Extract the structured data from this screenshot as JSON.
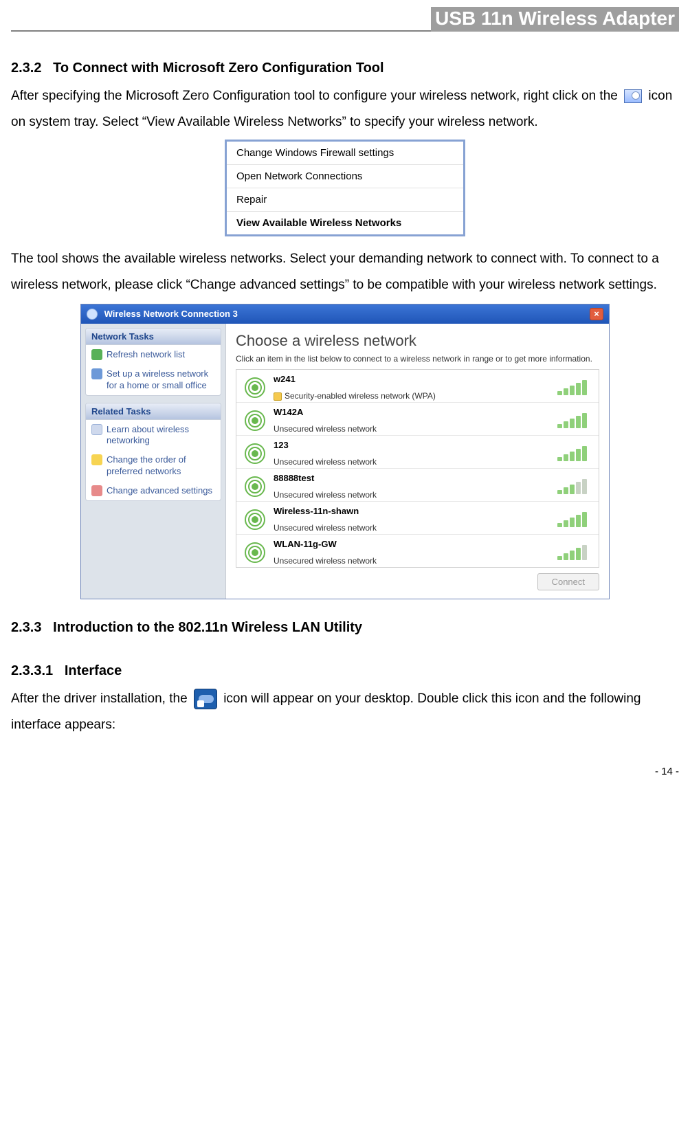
{
  "header": {
    "title": "USB 11n Wireless Adapter"
  },
  "sec_232": {
    "num": "2.3.2",
    "title": "To Connect with Microsoft Zero Configuration Tool",
    "para1a": "After specifying the Microsoft Zero Configuration tool to configure your wireless network, right click on the ",
    "para1b": " icon on system tray. Select “View Available Wireless Networks” to specify your wireless network.",
    "para2": "The tool shows the available wireless networks. Select your demanding network to connect with. To connect to a wireless network, please click “Change advanced settings” to be compatible with your wireless network settings."
  },
  "context_menu": {
    "items": [
      "Change Windows Firewall settings",
      "Open Network Connections",
      "Repair",
      "View Available Wireless Networks"
    ]
  },
  "wifi_window": {
    "title": "Wireless Network Connection 3",
    "sidebar": {
      "tasks_head": "Network Tasks",
      "tasks": [
        {
          "icon": "refresh",
          "label": "Refresh network list"
        },
        {
          "icon": "setup",
          "label": "Set up a wireless network for a home or small office"
        }
      ],
      "related_head": "Related Tasks",
      "related": [
        {
          "icon": "learn",
          "label": "Learn about wireless networking"
        },
        {
          "icon": "order",
          "label": "Change the order of preferred networks"
        },
        {
          "icon": "advanced",
          "label": "Change advanced settings"
        }
      ]
    },
    "main": {
      "heading": "Choose a wireless network",
      "hint": "Click an item in the list below to connect to a wireless network in range or to get more information.",
      "networks": [
        {
          "name": "w241",
          "desc": "Security-enabled wireless network (WPA)",
          "secure": true,
          "signal": 5
        },
        {
          "name": "W142A",
          "desc": "Unsecured wireless network",
          "secure": false,
          "signal": 5
        },
        {
          "name": "123",
          "desc": "Unsecured wireless network",
          "secure": false,
          "signal": 5
        },
        {
          "name": "88888test",
          "desc": "Unsecured wireless network",
          "secure": false,
          "signal": 3
        },
        {
          "name": "Wireless-11n-shawn",
          "desc": "Unsecured wireless network",
          "secure": false,
          "signal": 5
        },
        {
          "name": "WLAN-11g-GW",
          "desc": "Unsecured wireless network",
          "secure": false,
          "signal": 4
        }
      ],
      "connect_label": "Connect"
    }
  },
  "sec_233": {
    "num": "2.3.3",
    "title": "Introduction to the 802.11n Wireless LAN Utility"
  },
  "sec_2331": {
    "num": "2.3.3.1",
    "title": "Interface",
    "para_a": "After the driver installation, the ",
    "para_b": " icon will appear on your desktop. Double click this icon and the following interface appears:"
  },
  "footer": {
    "page": "- 14 -"
  }
}
